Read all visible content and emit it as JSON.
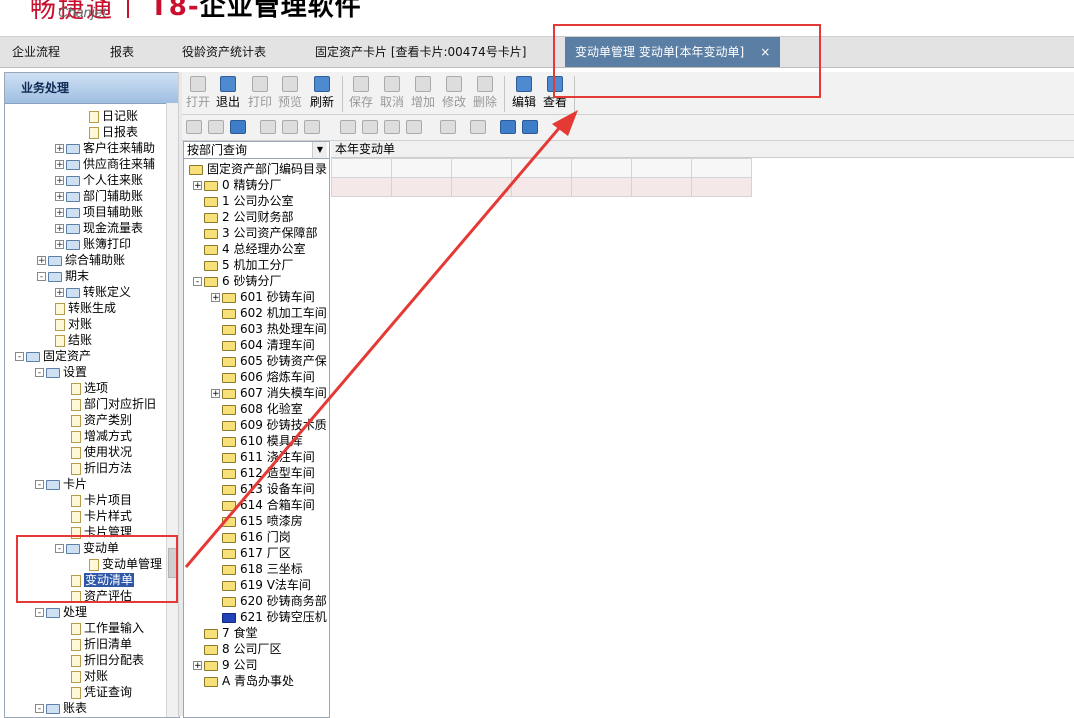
{
  "header": {
    "brand_cn": "畅捷通",
    "brand_en": "Chanjet",
    "app_title_prefix": "T8-",
    "app_title": "企业管理软件"
  },
  "tabs": [
    {
      "label": "企业流程"
    },
    {
      "label": "报表"
    },
    {
      "label": "役龄资产统计表"
    },
    {
      "label": "固定资产卡片 [查看卡片:00474号卡片]"
    },
    {
      "label": "变动单管理 变动单[本年变动单]",
      "close": "×"
    }
  ],
  "left_panel": {
    "title": "业务处理",
    "items": [
      {
        "label": "日记账"
      },
      {
        "label": "日报表"
      },
      {
        "label": "客户往来辅助"
      },
      {
        "label": "供应商往来辅"
      },
      {
        "label": "个人往来账"
      },
      {
        "label": "部门辅助账"
      },
      {
        "label": "项目辅助账"
      },
      {
        "label": "现金流量表"
      },
      {
        "label": "账簿打印"
      },
      {
        "label": "综合辅助账"
      },
      {
        "label": "期末"
      },
      {
        "label": "转账定义"
      },
      {
        "label": "转账生成"
      },
      {
        "label": "对账"
      },
      {
        "label": "结账"
      },
      {
        "label": "固定资产"
      },
      {
        "label": "设置"
      },
      {
        "label": "选项"
      },
      {
        "label": "部门对应折旧"
      },
      {
        "label": "资产类别"
      },
      {
        "label": "增减方式"
      },
      {
        "label": "使用状况"
      },
      {
        "label": "折旧方法"
      },
      {
        "label": "卡片"
      },
      {
        "label": "卡片项目"
      },
      {
        "label": "卡片样式"
      },
      {
        "label": "卡片管理"
      },
      {
        "label": "变动单"
      },
      {
        "label": "变动单管理"
      },
      {
        "label": "变动清单"
      },
      {
        "label": "资产评估"
      },
      {
        "label": "处理"
      },
      {
        "label": "工作量输入"
      },
      {
        "label": "折旧清单"
      },
      {
        "label": "折旧分配表"
      },
      {
        "label": "对账"
      },
      {
        "label": "凭证查询"
      },
      {
        "label": "账表"
      }
    ]
  },
  "toolbar": {
    "buttons": [
      {
        "label": "打开"
      },
      {
        "label": "退出"
      },
      {
        "label": "打印"
      },
      {
        "label": "预览"
      },
      {
        "label": "刷新"
      },
      {
        "label": "保存"
      },
      {
        "label": "取消"
      },
      {
        "label": "增加"
      },
      {
        "label": "修改"
      },
      {
        "label": "删除"
      },
      {
        "label": "编辑"
      },
      {
        "label": "查看"
      }
    ]
  },
  "dept_panel": {
    "selector": "按部门查询",
    "items": [
      {
        "label": "固定资产部门编码目录"
      },
      {
        "label": "0 精铸分厂"
      },
      {
        "label": "1 公司办公室"
      },
      {
        "label": "2 公司财务部"
      },
      {
        "label": "3 公司资产保障部"
      },
      {
        "label": "4 总经理办公室"
      },
      {
        "label": "5 机加工分厂"
      },
      {
        "label": "6 砂铸分厂"
      },
      {
        "label": "601 砂铸车间"
      },
      {
        "label": "602 机加工车间"
      },
      {
        "label": "603 热处理车间"
      },
      {
        "label": "604 清理车间"
      },
      {
        "label": "605 砂铸资产保"
      },
      {
        "label": "606 熔炼车间"
      },
      {
        "label": "607 消失模车间"
      },
      {
        "label": "608 化验室"
      },
      {
        "label": "609 砂铸技术质"
      },
      {
        "label": "610 模具库"
      },
      {
        "label": "611 浇注车间"
      },
      {
        "label": "612 造型车间"
      },
      {
        "label": "613 设备车间"
      },
      {
        "label": "614 合箱车间"
      },
      {
        "label": "615 喷漆房"
      },
      {
        "label": "616 门岗"
      },
      {
        "label": "617 厂区"
      },
      {
        "label": "618 三坐标"
      },
      {
        "label": "619 V法车间"
      },
      {
        "label": "620 砂铸商务部"
      },
      {
        "label": "621 砂铸空压机"
      },
      {
        "label": "7 食堂"
      },
      {
        "label": "8 公司厂区"
      },
      {
        "label": "9 公司"
      },
      {
        "label": "A 青岛办事处"
      }
    ]
  },
  "main": {
    "title": "本年变动单"
  },
  "colors": {
    "accent_tab": "#5b7ea4",
    "highlight": "#e53935",
    "selected_item": "#2f57a8"
  }
}
